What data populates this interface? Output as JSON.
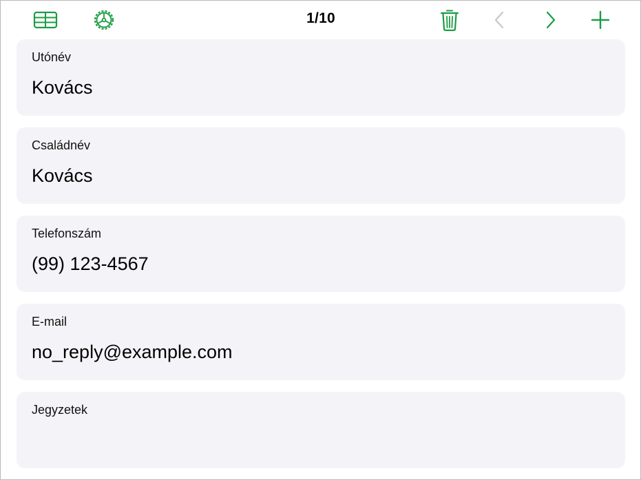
{
  "colors": {
    "accent": "#1a9c45",
    "disabled": "#c7c7cc",
    "card": "#f4f4f8"
  },
  "toolbar": {
    "table_icon": "table-view-icon",
    "settings_icon": "settings-gear-icon",
    "record_counter": "1/10",
    "delete_icon": "trash-icon",
    "previous_icon": "chevron-left-icon",
    "next_icon": "chevron-right-icon",
    "add_icon": "plus-icon"
  },
  "fields": [
    {
      "label": "Utónév",
      "value": "Kovács"
    },
    {
      "label": "Családnév",
      "value": "Kovács"
    },
    {
      "label": "Telefonszám",
      "value": "(99) 123-4567"
    },
    {
      "label": "E-mail",
      "value": "no_reply@example.com"
    },
    {
      "label": "Jegyzetek",
      "value": ""
    }
  ]
}
